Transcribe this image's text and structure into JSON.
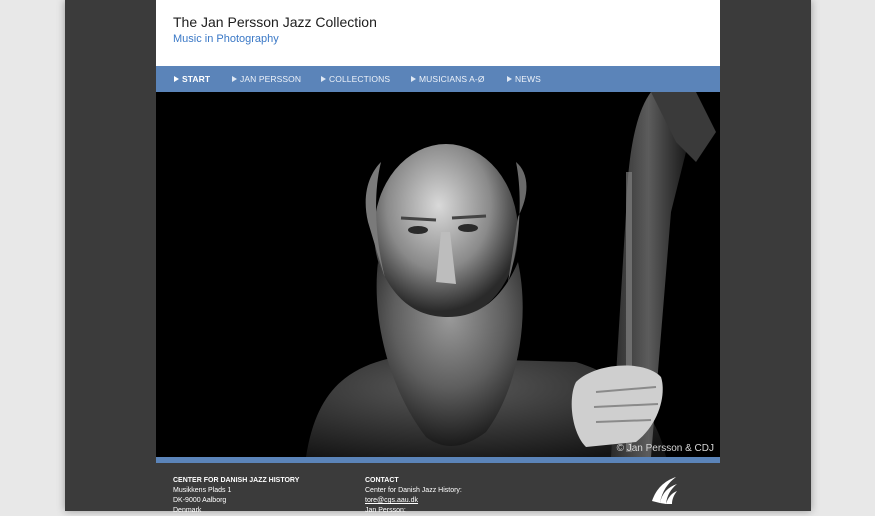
{
  "header": {
    "title": "The Jan Persson Jazz Collection",
    "subtitle": "Music in Photography"
  },
  "nav": {
    "items": [
      {
        "label": "Start"
      },
      {
        "label": "Jan Persson"
      },
      {
        "label": "Collections"
      },
      {
        "label": "Musicians A-Ø"
      },
      {
        "label": "News"
      }
    ]
  },
  "hero": {
    "credit": "© Jan Persson & CDJ"
  },
  "footer": {
    "col1": {
      "heading": "CENTER FOR DANISH JAZZ HISTORY",
      "lines": [
        "Musikkens Plads 1",
        "DK-9000 Aalborg",
        "Denmark"
      ]
    },
    "col2": {
      "heading": "CONTACT",
      "line1": "Center for Danish Jazz History:",
      "email": "tore@cgs.aau.dk",
      "line3": "Jan Persson:"
    }
  },
  "colors": {
    "nav": "#5b84b9",
    "subtitle": "#3a78c6",
    "frame": "#3b3b3b"
  }
}
